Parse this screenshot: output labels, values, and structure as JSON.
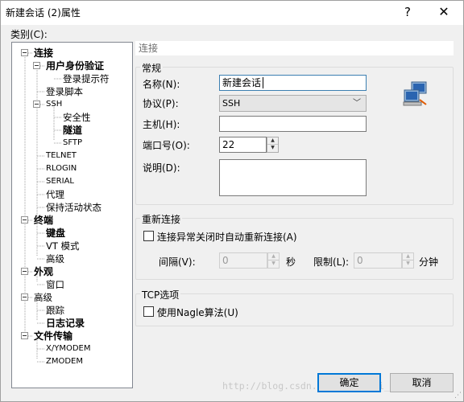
{
  "window": {
    "title": "新建会话 (2)属性",
    "help": "?",
    "close": "✕"
  },
  "category_label": "类别(C):",
  "tree": [
    {
      "id": "connection",
      "label": "连接",
      "bold": true,
      "small": false
    },
    {
      "id": "user-auth",
      "label": "用户身份验证",
      "bold": true,
      "small": false
    },
    {
      "id": "login-prompt",
      "label": "登录提示符",
      "bold": false,
      "small": false
    },
    {
      "id": "login-script",
      "label": "登录脚本",
      "bold": false,
      "small": false
    },
    {
      "id": "ssh",
      "label": "SSH",
      "bold": false,
      "small": true
    },
    {
      "id": "security",
      "label": "安全性",
      "bold": false,
      "small": false
    },
    {
      "id": "tunnel",
      "label": "隧道",
      "bold": true,
      "small": false
    },
    {
      "id": "sftp",
      "label": "SFTP",
      "bold": false,
      "small": true
    },
    {
      "id": "telnet",
      "label": "TELNET",
      "bold": false,
      "small": true
    },
    {
      "id": "rlogin",
      "label": "RLOGIN",
      "bold": false,
      "small": true
    },
    {
      "id": "serial",
      "label": "SERIAL",
      "bold": false,
      "small": true
    },
    {
      "id": "proxy",
      "label": "代理",
      "bold": false,
      "small": false
    },
    {
      "id": "keepalive",
      "label": "保持活动状态",
      "bold": false,
      "small": false
    },
    {
      "id": "terminal",
      "label": "终端",
      "bold": true,
      "small": false
    },
    {
      "id": "keyboard",
      "label": "键盘",
      "bold": true,
      "small": false
    },
    {
      "id": "vt-mode",
      "label": "VT 模式",
      "bold": false,
      "small": false
    },
    {
      "id": "terminal-advanced",
      "label": "高级",
      "bold": false,
      "small": false
    },
    {
      "id": "appearance",
      "label": "外观",
      "bold": true,
      "small": false
    },
    {
      "id": "window",
      "label": "窗口",
      "bold": false,
      "small": false
    },
    {
      "id": "advanced",
      "label": "高级",
      "bold": false,
      "small": false
    },
    {
      "id": "trace",
      "label": "跟踪",
      "bold": false,
      "small": false
    },
    {
      "id": "logging",
      "label": "日志记录",
      "bold": true,
      "small": false
    },
    {
      "id": "file-transfer",
      "label": "文件传输",
      "bold": true,
      "small": false
    },
    {
      "id": "xymodem",
      "label": "X/YMODEM",
      "bold": false,
      "small": true
    },
    {
      "id": "zmodem",
      "label": "ZMODEM",
      "bold": false,
      "small": true
    }
  ],
  "panel": {
    "header": "连接",
    "general": {
      "title": "常规",
      "name_label": "名称(N):",
      "name_value": "新建会话",
      "protocol_label": "协议(P):",
      "protocol_value": "SSH",
      "host_label": "主机(H):",
      "host_value": "",
      "port_label": "端口号(O):",
      "port_value": "22",
      "desc_label": "说明(D):",
      "desc_value": ""
    },
    "reconnect": {
      "title": "重新连接",
      "auto_reconnect_label": "连接异常关闭时自动重新连接(A)",
      "interval_label": "间隔(V):",
      "interval_value": "0",
      "interval_unit": "秒",
      "limit_label": "限制(L):",
      "limit_value": "0",
      "limit_unit": "分钟"
    },
    "tcp": {
      "title": "TCP选项",
      "nagle_label": "使用Nagle算法(U)"
    }
  },
  "buttons": {
    "ok": "确定",
    "cancel": "取消"
  },
  "watermark": "http://blog.csdn.net/wenyunqi_toyu"
}
